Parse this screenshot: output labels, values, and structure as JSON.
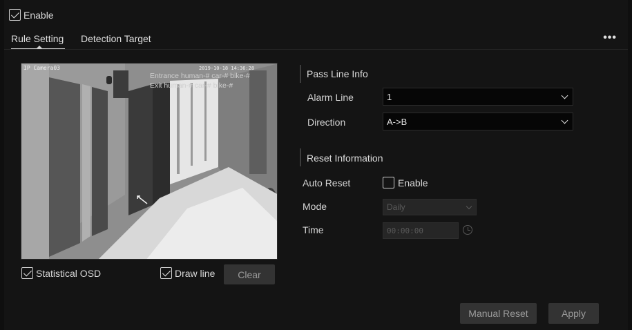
{
  "enable": {
    "label": "Enable",
    "checked": true
  },
  "tabs": [
    {
      "label": "Rule Setting",
      "active": true
    },
    {
      "label": "Detection Target",
      "active": false
    }
  ],
  "more": {
    "label": "•••"
  },
  "camera": {
    "name": "IP Camera03",
    "timestamp": "2019-10-18 14:36:28",
    "entrance": "Entrance human-# car-# bike-#",
    "exit": "Exit human-# car-# bike-#"
  },
  "osd": {
    "label": "Statistical OSD",
    "checked": true
  },
  "draw_line": {
    "label": "Draw line",
    "checked": true
  },
  "clear_label": "Clear",
  "pass_line": {
    "title": "Pass Line Info",
    "alarm_line_label": "Alarm Line",
    "alarm_line_value": "1",
    "direction_label": "Direction",
    "direction_value": "A->B"
  },
  "reset": {
    "title": "Reset Information",
    "auto_reset_label": "Auto Reset",
    "auto_reset_enable_label": "Enable",
    "auto_reset_checked": false,
    "mode_label": "Mode",
    "mode_value": "Daily",
    "time_label": "Time",
    "time_value": "00:00:00"
  },
  "buttons": {
    "manual_reset": "Manual Reset",
    "apply": "Apply"
  },
  "colors": {
    "background": "#141414",
    "input_bg": "#060606",
    "button_bg": "#333333",
    "disabled_text": "#5a5a5a"
  }
}
